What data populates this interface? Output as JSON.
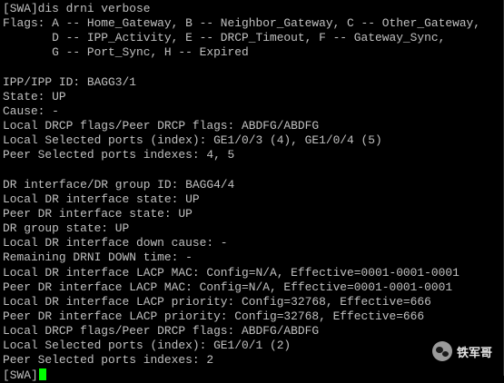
{
  "terminal": {
    "lines": [
      "[SWA]dis drni verbose",
      "Flags: A -- Home_Gateway, B -- Neighbor_Gateway, C -- Other_Gateway,",
      "       D -- IPP_Activity, E -- DRCP_Timeout, F -- Gateway_Sync,",
      "       G -- Port_Sync, H -- Expired",
      "",
      "IPP/IPP ID: BAGG3/1",
      "State: UP",
      "Cause: -",
      "Local DRCP flags/Peer DRCP flags: ABDFG/ABDFG",
      "Local Selected ports (index): GE1/0/3 (4), GE1/0/4 (5)",
      "Peer Selected ports indexes: 4, 5",
      "",
      "DR interface/DR group ID: BAGG4/4",
      "Local DR interface state: UP",
      "Peer DR interface state: UP",
      "DR group state: UP",
      "Local DR interface down cause: -",
      "Remaining DRNI DOWN time: -",
      "Local DR interface LACP MAC: Config=N/A, Effective=0001-0001-0001",
      "Peer DR interface LACP MAC: Config=N/A, Effective=0001-0001-0001",
      "Local DR interface LACP priority: Config=32768, Effective=666",
      "Peer DR interface LACP priority: Config=32768, Effective=666",
      "Local DRCP flags/Peer DRCP flags: ABDFG/ABDFG",
      "Local Selected ports (index): GE1/0/1 (2)",
      "Peer Selected ports indexes: 2"
    ],
    "prompt": "[SWA]"
  },
  "watermark": {
    "label": "铁军哥",
    "icon": "wechat-icon"
  },
  "colors": {
    "background": "#000000",
    "text": "#c0c0c0",
    "cursor": "#00ff00"
  }
}
